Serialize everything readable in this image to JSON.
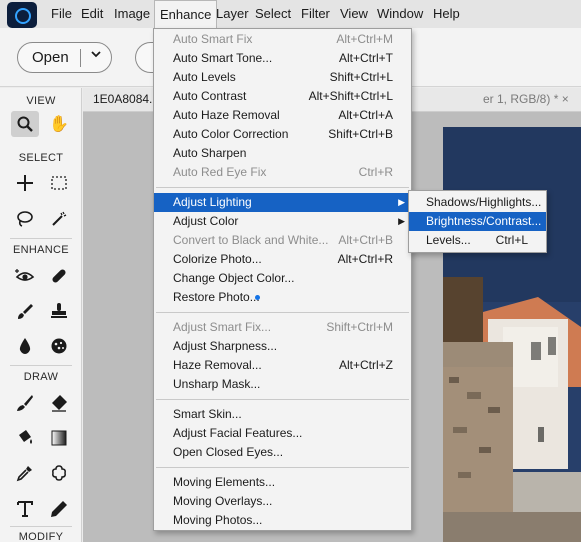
{
  "menubar": {
    "items": [
      "File",
      "Edit",
      "Image",
      "Enhance",
      "Layer",
      "Select",
      "Filter",
      "View",
      "Window",
      "Help"
    ],
    "active": "Enhance"
  },
  "toolbar": {
    "open_label": "Open",
    "open_chevron": "⌄"
  },
  "tools": {
    "sections": [
      "VIEW",
      "SELECT",
      "ENHANCE",
      "DRAW",
      "MODIFY"
    ],
    "icons": [
      "zoom-icon",
      "hand-icon",
      "move-icon",
      "marquee-icon",
      "lasso-icon",
      "magic-wand-icon",
      "red-eye-icon",
      "spot-healing-icon",
      "smart-brush-icon",
      "clone-stamp-icon",
      "blur-icon",
      "sponge-icon",
      "brush-icon",
      "eraser-icon",
      "paint-bucket-icon",
      "gradient-icon",
      "eyedropper-icon",
      "custom-shape-icon",
      "type-icon",
      "pencil-icon"
    ],
    "selected": "zoom-icon"
  },
  "document": {
    "tab_name": "1E0A8084.CR",
    "tab_suffix": "er 1, RGB/8) * ×"
  },
  "enhance_menu": {
    "groups": [
      [
        {
          "label": "Auto Smart Fix",
          "shortcut": "Alt+Ctrl+M",
          "disabled": true
        },
        {
          "label": "Auto Smart Tone...",
          "shortcut": "Alt+Ctrl+T"
        },
        {
          "label": "Auto Levels",
          "shortcut": "Shift+Ctrl+L"
        },
        {
          "label": "Auto Contrast",
          "shortcut": "Alt+Shift+Ctrl+L"
        },
        {
          "label": "Auto Haze Removal",
          "shortcut": "Alt+Ctrl+A"
        },
        {
          "label": "Auto Color Correction",
          "shortcut": "Shift+Ctrl+B"
        },
        {
          "label": "Auto Sharpen",
          "shortcut": ""
        },
        {
          "label": "Auto Red Eye Fix",
          "shortcut": "Ctrl+R",
          "disabled": true
        }
      ],
      [
        {
          "label": "Adjust Lighting",
          "shortcut": "",
          "submenu": true,
          "highlight": true
        },
        {
          "label": "Adjust Color",
          "shortcut": "",
          "submenu": true
        },
        {
          "label": "Convert to Black and White...",
          "shortcut": "Alt+Ctrl+B",
          "disabled": true
        },
        {
          "label": "Colorize Photo...",
          "shortcut": "Alt+Ctrl+R"
        },
        {
          "label": "Change Object Color...",
          "shortcut": ""
        },
        {
          "label": "Restore Photo...",
          "shortcut": "",
          "new_badge": true
        }
      ],
      [
        {
          "label": "Adjust Smart Fix...",
          "shortcut": "Shift+Ctrl+M",
          "disabled": true
        },
        {
          "label": "Adjust Sharpness...",
          "shortcut": ""
        },
        {
          "label": "Haze Removal...",
          "shortcut": "Alt+Ctrl+Z"
        },
        {
          "label": "Unsharp Mask...",
          "shortcut": ""
        }
      ],
      [
        {
          "label": "Smart Skin...",
          "shortcut": ""
        },
        {
          "label": "Adjust Facial Features...",
          "shortcut": ""
        },
        {
          "label": "Open Closed Eyes...",
          "shortcut": ""
        }
      ],
      [
        {
          "label": "Moving Elements...",
          "shortcut": ""
        },
        {
          "label": "Moving Overlays...",
          "shortcut": ""
        },
        {
          "label": "Moving Photos...",
          "shortcut": ""
        }
      ]
    ]
  },
  "lighting_submenu": {
    "items": [
      {
        "label": "Shadows/Highlights...",
        "shortcut": ""
      },
      {
        "label": "Brightness/Contrast...",
        "shortcut": "",
        "highlight": true
      },
      {
        "label": "Levels...",
        "shortcut": "Ctrl+L"
      }
    ]
  },
  "colors": {
    "highlight": "#1662c4",
    "menubar_bg": "#e4e4e4",
    "panel_bg": "#f3f3f3",
    "canvas_bg": "#bcbcbc",
    "sky": "#243c66"
  }
}
